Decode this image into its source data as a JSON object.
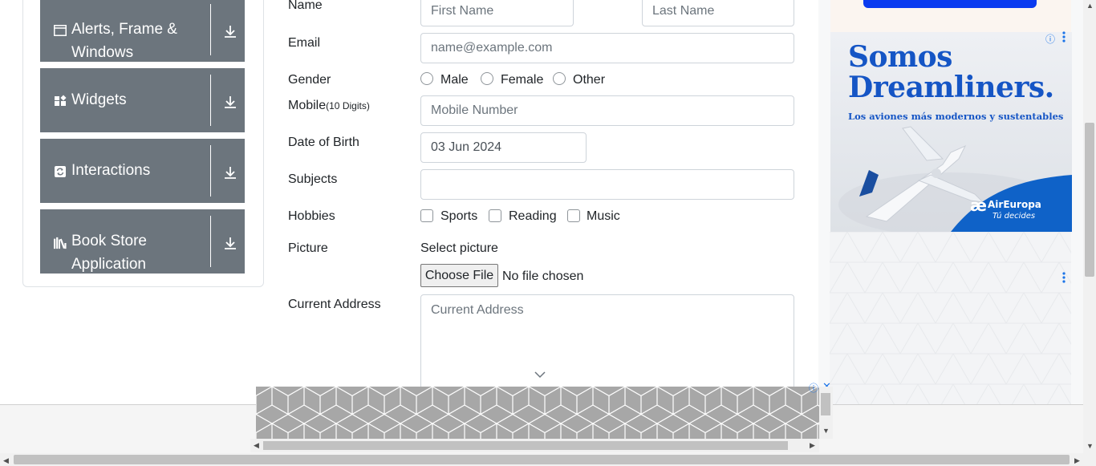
{
  "sidebar": {
    "groups": [
      {
        "label": "Alerts, Frame & Windows",
        "icon": "window-icon"
      },
      {
        "label": "Widgets",
        "icon": "widgets-icon"
      },
      {
        "label": "Interactions",
        "icon": "interactions-icon"
      },
      {
        "label": "Book Store Application",
        "icon": "books-icon"
      }
    ]
  },
  "form": {
    "name_label": "Name",
    "first_name_placeholder": "First Name",
    "last_name_placeholder": "Last Name",
    "email_label": "Email",
    "email_placeholder": "name@example.com",
    "gender_label": "Gender",
    "gender_options": [
      "Male",
      "Female",
      "Other"
    ],
    "mobile_label": "Mobile",
    "mobile_hint": "(10 Digits)",
    "mobile_placeholder": "Mobile Number",
    "dob_label": "Date of Birth",
    "dob_value": "03 Jun 2024",
    "subjects_label": "Subjects",
    "subjects_value": "",
    "hobbies_label": "Hobbies",
    "hobbies_options": [
      "Sports",
      "Reading",
      "Music"
    ],
    "picture_label": "Picture",
    "select_picture_label": "Select picture",
    "choose_file_button": "Choose File",
    "file_status": "No file chosen",
    "address_label": "Current Address",
    "address_placeholder": "Current Address"
  },
  "ad": {
    "headline": "Somos Dreamliners.",
    "subline": "Los aviones más modernos y sustentables",
    "brand": "AirEuropa",
    "tagline": "Tú decides"
  },
  "colors": {
    "sidebar_bg": "#6c757d",
    "ad_blue": "#1555c5",
    "brand_blue": "#0f62c8"
  }
}
